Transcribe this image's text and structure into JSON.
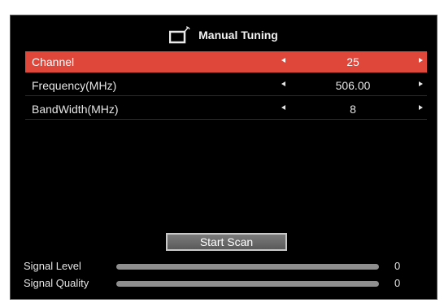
{
  "header": {
    "icon": "tv-antenna-icon",
    "title": "Manual Tuning"
  },
  "settings": [
    {
      "label": "Channel",
      "value": "25",
      "selected": true
    },
    {
      "label": "Frequency(MHz)",
      "value": "506.00",
      "selected": false
    },
    {
      "label": "BandWidth(MHz)",
      "value": "8",
      "selected": false
    }
  ],
  "actions": {
    "start_scan_label": "Start Scan"
  },
  "meters": [
    {
      "label": "Signal Level",
      "value": "0",
      "level_percent": 0
    },
    {
      "label": "Signal Quality",
      "value": "0",
      "level_percent": 0
    }
  ],
  "colors": {
    "highlight": "#e0473b",
    "background": "#000000",
    "text": "#e6e6e6"
  }
}
